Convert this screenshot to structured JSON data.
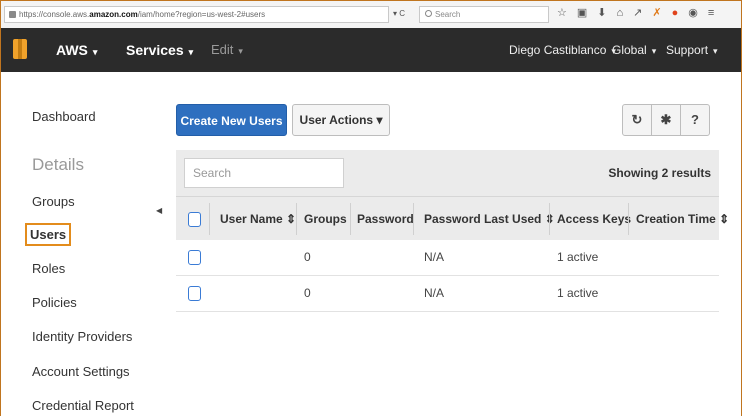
{
  "browser": {
    "url_prefix": "https://console.aws.",
    "url_domain": "amazon.com",
    "url_path": "/iam/home?region=us-west-2#users",
    "reload_controls": "▾ C",
    "search_placeholder": "Search",
    "toolbar_icons": [
      "star-icon",
      "clipboard-icon",
      "download-icon",
      "home-icon",
      "arrow-icon",
      "extension-icon",
      "adblock-icon",
      "pocket-icon",
      "menu-icon"
    ]
  },
  "nav": {
    "brand": "AWS",
    "services": "Services",
    "edit": "Edit",
    "user": "Diego Castiblanco",
    "region": "Global",
    "support": "Support",
    "caret": "▾"
  },
  "sidebar": {
    "dashboard": "Dashboard",
    "details_heading": "Details",
    "items": [
      {
        "label": "Groups"
      },
      {
        "label": "Users"
      },
      {
        "label": "Roles"
      },
      {
        "label": "Policies"
      },
      {
        "label": "Identity Providers"
      },
      {
        "label": "Account Settings"
      },
      {
        "label": "Credential Report"
      }
    ],
    "active_item": "Users"
  },
  "toolbar": {
    "create_label": "Create New Users",
    "actions_label": "User Actions ▾",
    "refresh_icon": "↻",
    "settings_icon": "✱",
    "help_icon": "?"
  },
  "table": {
    "search_placeholder": "Search",
    "results_text": "Showing 2 results",
    "columns": [
      "User Name ⇕",
      "Groups",
      "Password",
      "Password Last Used ⇕",
      "Access Keys",
      "Creation Time ⇕"
    ],
    "rows": [
      {
        "user_name": "",
        "groups": "0",
        "password": "",
        "password_last_used": "N/A",
        "access_keys": "1 active",
        "creation_time": ""
      },
      {
        "user_name": "",
        "groups": "0",
        "password": "",
        "password_last_used": "N/A",
        "access_keys": "1 active",
        "creation_time": ""
      }
    ]
  },
  "colors": {
    "nav_bg": "#2b2b2b",
    "primary_button": "#2e6fbf",
    "active_outline": "#e38c1c",
    "aws_logo": "#f0a22b"
  }
}
